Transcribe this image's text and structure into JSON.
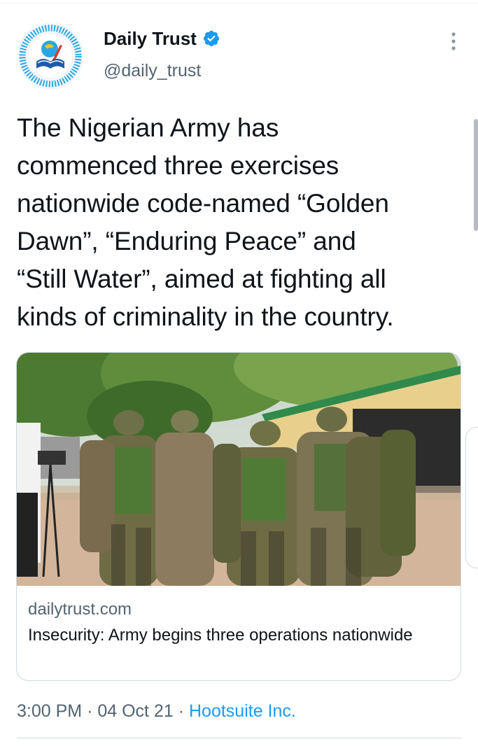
{
  "tweet": {
    "display_name": "Daily Trust",
    "handle": "@daily_trust",
    "text": "The Nigerian Army has\ncommenced three exercises\nnationwide code-named “Golden\nDawn”, “Enduring Peace” and\n“Still Water”, aimed at fighting all\nkinds of criminality in the country.",
    "time": "3:00 PM",
    "date": "04 Oct 21",
    "source": "Hootsuite Inc.",
    "separator": "·"
  },
  "card": {
    "domain": "dailytrust.com",
    "title": "Insecurity: Army begins three operations nationwide"
  },
  "icons": {
    "verified": "verified-badge-icon",
    "more": "more-vertical-icon",
    "avatar": "daily-trust-logo"
  },
  "colors": {
    "accent": "#1d9bf0",
    "secondary_text": "#536471",
    "primary_text": "#0f1419",
    "border": "#cfd9de"
  }
}
